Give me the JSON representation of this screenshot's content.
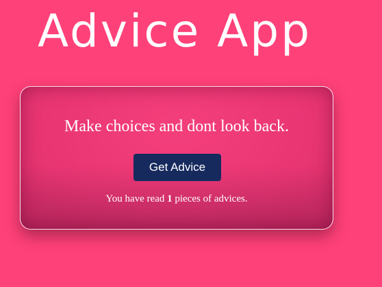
{
  "app": {
    "title": "Advice App"
  },
  "card": {
    "advice": "Make choices and dont look back.",
    "button_label": "Get Advice",
    "count_prefix": "You have read",
    "count_value": "1",
    "count_suffix": "pieces of advices."
  },
  "colors": {
    "background": "#ff4179",
    "button": "#172a5e",
    "text": "#ffffff"
  }
}
